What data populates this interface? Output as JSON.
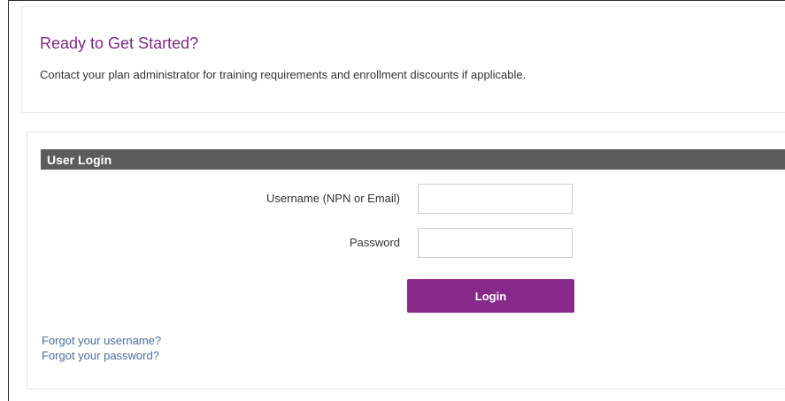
{
  "intro": {
    "title": "Ready to Get Started?",
    "text": "Contact your plan administrator for training requirements and enrollment discounts if applicable."
  },
  "login": {
    "header": "User Login",
    "username_label": "Username (NPN or Email)",
    "username_value": "",
    "password_label": "Password",
    "password_value": "",
    "button_label": "Login",
    "forgot_username": "Forgot your username?",
    "forgot_password": "Forgot your password?"
  },
  "colors": {
    "accent": "#862989",
    "title": "#7b2b80",
    "header_bar": "#5c5c5c",
    "link": "#4b6f9b"
  }
}
